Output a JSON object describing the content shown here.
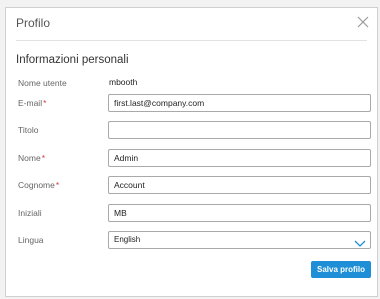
{
  "dialog": {
    "title": "Profilo",
    "close_icon": "close-icon"
  },
  "section": {
    "title": "Informazioni personali"
  },
  "fields": {
    "username": {
      "label": "Nome utente",
      "value": "mbooth"
    },
    "email": {
      "label": "E-mail",
      "required_mark": "*",
      "value": "first.last@company.com"
    },
    "titolo": {
      "label": "Titolo",
      "value": ""
    },
    "nome": {
      "label": "Nome",
      "required_mark": "*",
      "value": "Admin"
    },
    "cognome": {
      "label": "Cognome",
      "required_mark": "*",
      "value": "Account"
    },
    "iniziali": {
      "label": "Iniziali",
      "value": "MB"
    },
    "lingua": {
      "label": "Lingua",
      "value": "English",
      "icon": "chevron-down-icon"
    }
  },
  "actions": {
    "save_label": "Salva profilo"
  },
  "colors": {
    "accent": "#1e8fd6",
    "required": "#d63b3b"
  }
}
